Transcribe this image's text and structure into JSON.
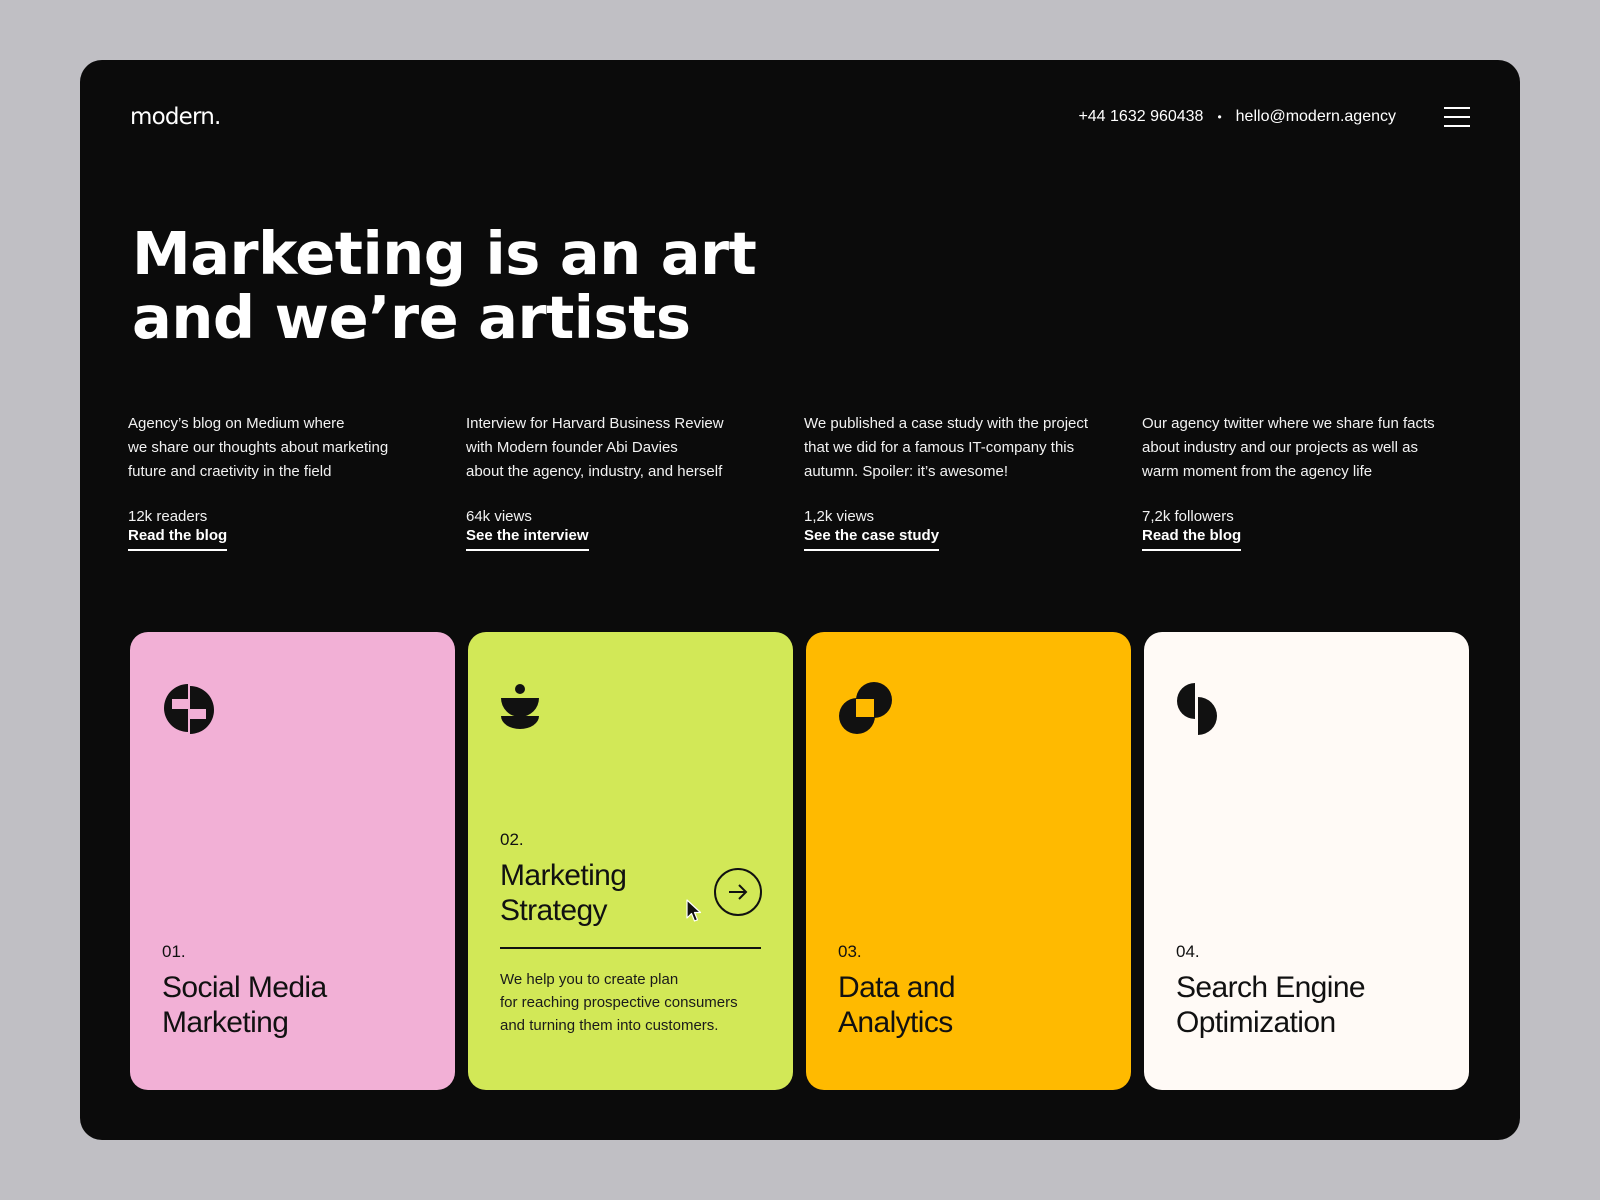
{
  "header": {
    "logo": "modern.",
    "phone": "+44 1632 960438",
    "separator": "•",
    "email": "hello@modern.agency",
    "menu_icon": "hamburger-menu-icon"
  },
  "hero": {
    "headline_line1": "Marketing is an art",
    "headline_line2": "and we’re artists"
  },
  "media": [
    {
      "desc_lines": [
        "Agency’s blog on Medium where",
        "we share our thoughts about marketing",
        "future and craetivity in the field"
      ],
      "stat": "12k readers",
      "link": "Read the blog"
    },
    {
      "desc_lines": [
        "Interview for Harvard Business Review",
        "with Modern founder Abi Davies",
        "about the agency, industry, and herself"
      ],
      "stat": "64k views",
      "link": "See the interview"
    },
    {
      "desc_lines": [
        "We published a case study with the project",
        "that we did for a famous IT-company this",
        "autumn. Spoiler: it’s awesome!"
      ],
      "stat": "1,2k views",
      "link": "See the case study"
    },
    {
      "desc_lines": [
        "Our agency twitter where we share fun facts",
        "about industry and our projects as well as",
        "warm moment from the agency life"
      ],
      "stat": "7,2k followers",
      "link": "Read the blog"
    }
  ],
  "services": [
    {
      "num": "01.",
      "title_line1": "Social Media",
      "title_line2": "Marketing",
      "color": "#f2b0d6",
      "icon": "pinwheel-icon"
    },
    {
      "num": "02.",
      "title_line1": "Marketing",
      "title_line2": "Strategy",
      "color": "#d2e857",
      "icon": "stacked-bowls-icon",
      "body_lines": [
        "We help you to create plan",
        "for reaching prospective consumers",
        "and turning them into customers."
      ],
      "action_icon": "arrow-right-icon"
    },
    {
      "num": "03.",
      "title_line1": "Data and",
      "title_line2": "Analytics",
      "color": "#ffba00",
      "icon": "overlapping-circles-icon"
    },
    {
      "num": "04.",
      "title_line1": "Search Engine",
      "title_line2": "Optimization",
      "color": "#fffaf6",
      "icon": "split-circle-icon"
    }
  ]
}
